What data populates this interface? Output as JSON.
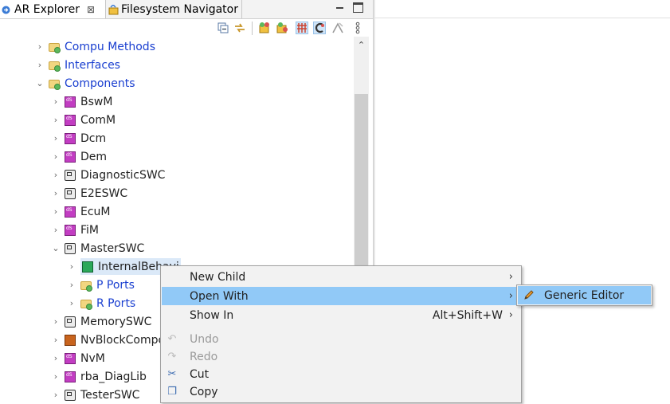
{
  "tabs": [
    {
      "label": "AR Explorer",
      "close": "⊠",
      "active": true
    },
    {
      "label": "Filesystem Navigator",
      "active": false
    }
  ],
  "toolbar": {
    "icons": [
      "collapse-all-icon",
      "link-with-editor-icon",
      "filter-icon-1",
      "filter-icon-2",
      "filter-icon-3",
      "filter-icon-4",
      "filter-icon-5",
      "view-menu-icon"
    ]
  },
  "tree": [
    {
      "label": "Compu Methods",
      "icon": "folder-icon",
      "expander": "›",
      "link": true
    },
    {
      "label": "Interfaces",
      "icon": "folder-icon",
      "expander": "›",
      "link": true
    },
    {
      "label": "Components",
      "icon": "folder-icon",
      "expander": "⌄",
      "link": true
    },
    {
      "label": "BswM",
      "icon": "bsw-module-icon",
      "expander": "›"
    },
    {
      "label": "ComM",
      "icon": "bsw-module-icon",
      "expander": "›"
    },
    {
      "label": "Dcm",
      "icon": "bsw-module-icon",
      "expander": "›"
    },
    {
      "label": "Dem",
      "icon": "bsw-module-icon",
      "expander": "›"
    },
    {
      "label": "DiagnosticSWC",
      "icon": "swc-icon",
      "expander": "›"
    },
    {
      "label": "E2ESWC",
      "icon": "swc-icon",
      "expander": "›"
    },
    {
      "label": "EcuM",
      "icon": "bsw-module-icon",
      "expander": "›"
    },
    {
      "label": "FiM",
      "icon": "bsw-module-icon",
      "expander": "›"
    },
    {
      "label": "MasterSWC",
      "icon": "swc-icon",
      "expander": "⌄"
    },
    {
      "label": "InternalBehavi",
      "icon": "internal-behavior-icon",
      "expander": "›",
      "selected": true
    },
    {
      "label": "P Ports",
      "icon": "folder-icon",
      "expander": "›",
      "link": true
    },
    {
      "label": "R Ports",
      "icon": "folder-icon",
      "expander": "›",
      "link": true
    },
    {
      "label": "MemorySWC",
      "icon": "swc-icon",
      "expander": "›"
    },
    {
      "label": "NvBlockCompo",
      "icon": "nvblock-icon",
      "expander": "›"
    },
    {
      "label": "NvM",
      "icon": "bsw-module-icon",
      "expander": "›"
    },
    {
      "label": "rba_DiagLib",
      "icon": "bsw-module-icon",
      "expander": "›"
    },
    {
      "label": "TesterSWC",
      "icon": "swc-icon",
      "expander": "›"
    }
  ],
  "context_menu": {
    "items": [
      {
        "label": "New Child",
        "arrow": "›",
        "enabled": true
      },
      {
        "label": "Open With",
        "arrow": "›",
        "enabled": true,
        "highlighted": true
      },
      {
        "label": "Show In",
        "shortcut": "Alt+Shift+W",
        "arrow": "›",
        "enabled": true
      },
      {
        "label": "Undo",
        "icon": "undo-icon",
        "glyph": "↶",
        "enabled": false
      },
      {
        "label": "Redo",
        "icon": "redo-icon",
        "glyph": "↷",
        "enabled": false
      },
      {
        "label": "Cut",
        "icon": "cut-icon",
        "glyph": "✂",
        "enabled": true
      },
      {
        "label": "Copy",
        "icon": "copy-icon",
        "glyph": "❐",
        "enabled": true
      }
    ]
  },
  "submenu": {
    "label": "Generic Editor",
    "icon": "pencil-icon"
  },
  "colors": {
    "highlight": "#91c9f7",
    "link_text": "#1a3fd0",
    "menu_bg": "#f2f2f2"
  }
}
